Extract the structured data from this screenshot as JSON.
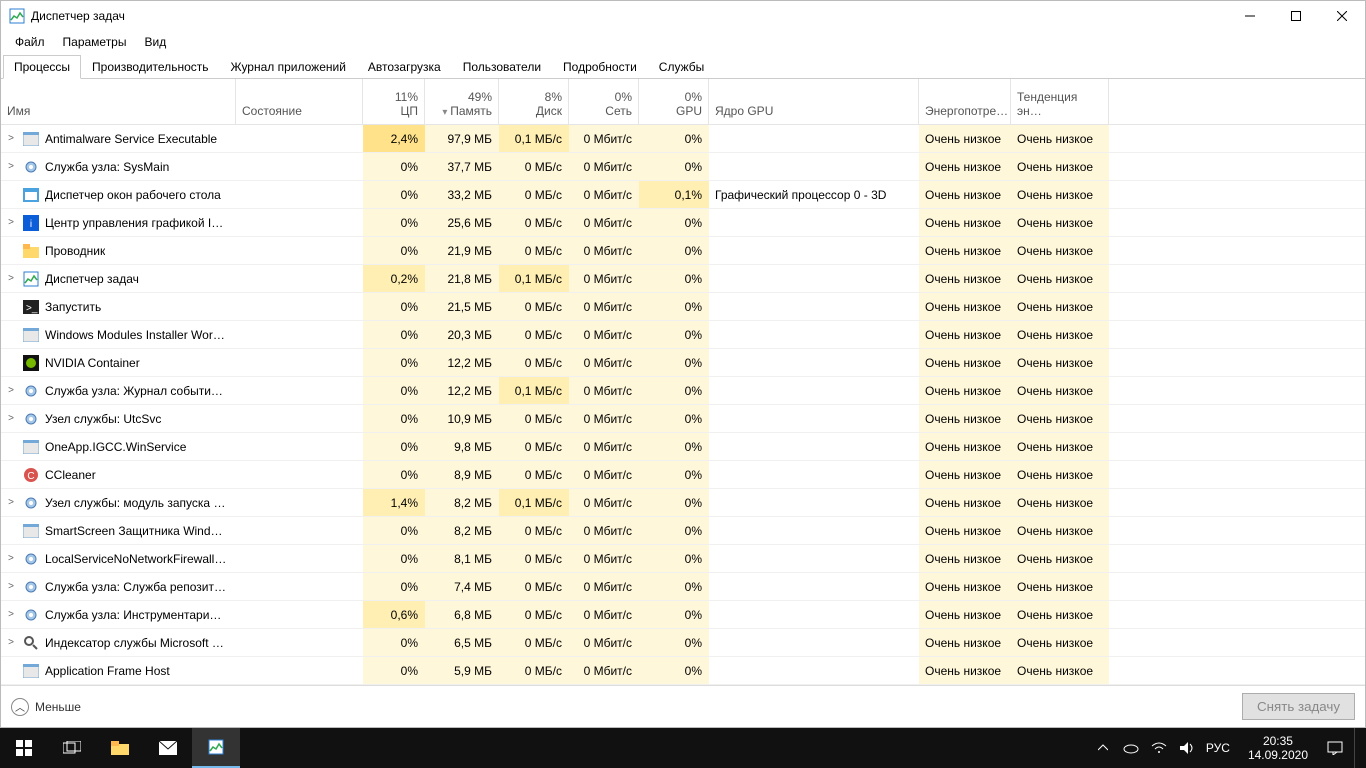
{
  "window": {
    "title": "Диспетчер задач"
  },
  "menu": {
    "file": "Файл",
    "options": "Параметры",
    "view": "Вид"
  },
  "tabs": {
    "items": [
      "Процессы",
      "Производительность",
      "Журнал приложений",
      "Автозагрузка",
      "Пользователи",
      "Подробности",
      "Службы"
    ],
    "active": 0
  },
  "columns": {
    "name": {
      "label": "Имя"
    },
    "state": {
      "label": "Состояние"
    },
    "cpu": {
      "label": "ЦП",
      "usage": "11%"
    },
    "mem": {
      "label": "Память",
      "usage": "49%"
    },
    "disk": {
      "label": "Диск",
      "usage": "8%"
    },
    "net": {
      "label": "Сеть",
      "usage": "0%"
    },
    "gpu": {
      "label": "GPU",
      "usage": "0%"
    },
    "gpucore": {
      "label": "Ядро GPU"
    },
    "power": {
      "label": "Энергопотре…"
    },
    "powertrend": {
      "label": "Тенденция эн…"
    }
  },
  "power_value": "Очень низкое",
  "processes": [
    {
      "exp": true,
      "icon": "app",
      "name": "Antimalware Service Executable",
      "cpu": "2,4%",
      "cpu_h": 2,
      "mem": "97,9 МБ",
      "disk": "0,1 МБ/с",
      "disk_h": 1,
      "net": "0 Мбит/c",
      "gpu": "0%",
      "gpucore": ""
    },
    {
      "exp": true,
      "icon": "gear",
      "name": "Служба узла: SysMain",
      "cpu": "0%",
      "cpu_h": 0,
      "mem": "37,7 МБ",
      "disk": "0 МБ/с",
      "disk_h": 0,
      "net": "0 Мбит/c",
      "gpu": "0%",
      "gpucore": ""
    },
    {
      "exp": false,
      "icon": "window",
      "name": "Диспетчер окон рабочего стола",
      "cpu": "0%",
      "cpu_h": 0,
      "mem": "33,2 МБ",
      "disk": "0 МБ/с",
      "disk_h": 0,
      "net": "0 Мбит/c",
      "gpu": "0,1%",
      "gpu_h": 1,
      "gpucore": "Графический процессор 0 - 3D"
    },
    {
      "exp": true,
      "icon": "intel",
      "name": "Центр управления графикой I…",
      "cpu": "0%",
      "cpu_h": 0,
      "mem": "25,6 МБ",
      "disk": "0 МБ/с",
      "disk_h": 0,
      "net": "0 Мбит/c",
      "gpu": "0%",
      "gpucore": ""
    },
    {
      "exp": false,
      "icon": "folder",
      "name": "Проводник",
      "cpu": "0%",
      "cpu_h": 0,
      "mem": "21,9 МБ",
      "disk": "0 МБ/с",
      "disk_h": 0,
      "net": "0 Мбит/c",
      "gpu": "0%",
      "gpucore": ""
    },
    {
      "exp": true,
      "icon": "tm",
      "name": "Диспетчер задач",
      "cpu": "0,2%",
      "cpu_h": 1,
      "mem": "21,8 МБ",
      "disk": "0,1 МБ/с",
      "disk_h": 1,
      "net": "0 Мбит/c",
      "gpu": "0%",
      "gpucore": ""
    },
    {
      "exp": false,
      "icon": "cmd",
      "name": "Запустить",
      "cpu": "0%",
      "cpu_h": 0,
      "mem": "21,5 МБ",
      "disk": "0 МБ/с",
      "disk_h": 0,
      "net": "0 Мбит/c",
      "gpu": "0%",
      "gpucore": ""
    },
    {
      "exp": false,
      "icon": "app",
      "name": "Windows Modules Installer Wor…",
      "cpu": "0%",
      "cpu_h": 0,
      "mem": "20,3 МБ",
      "disk": "0 МБ/с",
      "disk_h": 0,
      "net": "0 Мбит/c",
      "gpu": "0%",
      "gpucore": ""
    },
    {
      "exp": false,
      "icon": "nvidia",
      "name": "NVIDIA Container",
      "cpu": "0%",
      "cpu_h": 0,
      "mem": "12,2 МБ",
      "disk": "0 МБ/с",
      "disk_h": 0,
      "net": "0 Мбит/c",
      "gpu": "0%",
      "gpucore": ""
    },
    {
      "exp": true,
      "icon": "gear",
      "name": "Служба узла: Журнал событи…",
      "cpu": "0%",
      "cpu_h": 0,
      "mem": "12,2 МБ",
      "disk": "0,1 МБ/с",
      "disk_h": 1,
      "net": "0 Мбит/c",
      "gpu": "0%",
      "gpucore": ""
    },
    {
      "exp": true,
      "icon": "gear",
      "name": "Узел службы: UtcSvc",
      "cpu": "0%",
      "cpu_h": 0,
      "mem": "10,9 МБ",
      "disk": "0 МБ/с",
      "disk_h": 0,
      "net": "0 Мбит/c",
      "gpu": "0%",
      "gpucore": ""
    },
    {
      "exp": false,
      "icon": "app",
      "name": "OneApp.IGCC.WinService",
      "cpu": "0%",
      "cpu_h": 0,
      "mem": "9,8 МБ",
      "disk": "0 МБ/с",
      "disk_h": 0,
      "net": "0 Мбит/c",
      "gpu": "0%",
      "gpucore": ""
    },
    {
      "exp": false,
      "icon": "cc",
      "name": "CCleaner",
      "cpu": "0%",
      "cpu_h": 0,
      "mem": "8,9 МБ",
      "disk": "0 МБ/с",
      "disk_h": 0,
      "net": "0 Мбит/c",
      "gpu": "0%",
      "gpucore": ""
    },
    {
      "exp": true,
      "icon": "gear",
      "name": "Узел службы: модуль запуска …",
      "cpu": "1,4%",
      "cpu_h": 1,
      "mem": "8,2 МБ",
      "disk": "0,1 МБ/с",
      "disk_h": 1,
      "net": "0 Мбит/c",
      "gpu": "0%",
      "gpucore": ""
    },
    {
      "exp": false,
      "icon": "app",
      "name": "SmartScreen Защитника Windo…",
      "cpu": "0%",
      "cpu_h": 0,
      "mem": "8,2 МБ",
      "disk": "0 МБ/с",
      "disk_h": 0,
      "net": "0 Мбит/c",
      "gpu": "0%",
      "gpucore": ""
    },
    {
      "exp": true,
      "icon": "gear",
      "name": "LocalServiceNoNetworkFirewall …",
      "cpu": "0%",
      "cpu_h": 0,
      "mem": "8,1 МБ",
      "disk": "0 МБ/с",
      "disk_h": 0,
      "net": "0 Мбит/c",
      "gpu": "0%",
      "gpucore": ""
    },
    {
      "exp": true,
      "icon": "gear",
      "name": "Служба узла: Служба репозит…",
      "cpu": "0%",
      "cpu_h": 0,
      "mem": "7,4 МБ",
      "disk": "0 МБ/с",
      "disk_h": 0,
      "net": "0 Мбит/c",
      "gpu": "0%",
      "gpucore": ""
    },
    {
      "exp": true,
      "icon": "gear",
      "name": "Служба узла: Инструментари…",
      "cpu": "0,6%",
      "cpu_h": 1,
      "mem": "6,8 МБ",
      "disk": "0 МБ/с",
      "disk_h": 0,
      "net": "0 Мбит/c",
      "gpu": "0%",
      "gpucore": ""
    },
    {
      "exp": true,
      "icon": "search",
      "name": "Индексатор службы Microsoft …",
      "cpu": "0%",
      "cpu_h": 0,
      "mem": "6,5 МБ",
      "disk": "0 МБ/с",
      "disk_h": 0,
      "net": "0 Мбит/c",
      "gpu": "0%",
      "gpucore": ""
    },
    {
      "exp": false,
      "icon": "app",
      "name": "Application Frame Host",
      "cpu": "0%",
      "cpu_h": 0,
      "mem": "5,9 МБ",
      "disk": "0 МБ/с",
      "disk_h": 0,
      "net": "0 Мбит/c",
      "gpu": "0%",
      "gpucore": ""
    }
  ],
  "footer": {
    "fewer": "Меньше",
    "endtask": "Снять задачу"
  },
  "taskbar": {
    "lang": "РУС",
    "time": "20:35",
    "date": "14.09.2020"
  }
}
